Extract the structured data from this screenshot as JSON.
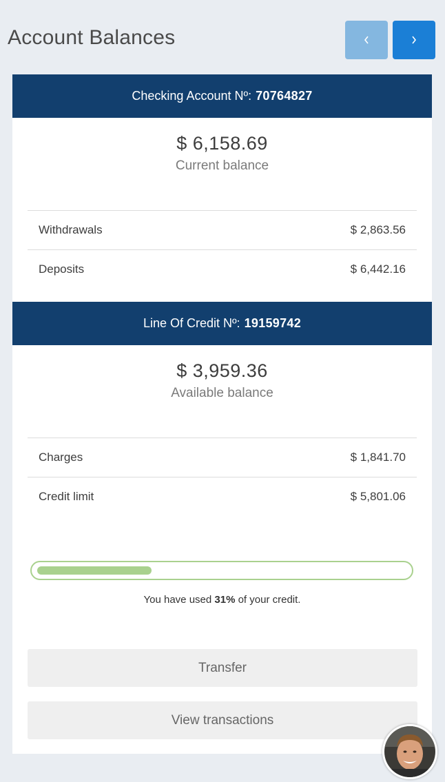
{
  "header": {
    "title": "Account Balances",
    "prev_label": "‹",
    "next_label": "›"
  },
  "checking": {
    "header_label": "Checking Account Nº:",
    "number": "70764827",
    "amount": "$ 6,158.69",
    "amount_label": "Current balance",
    "rows": [
      {
        "label": "Withdrawals",
        "value": "$ 2,863.56"
      },
      {
        "label": "Deposits",
        "value": "$ 6,442.16"
      }
    ]
  },
  "credit": {
    "header_label": "Line Of Credit Nº:",
    "number": "19159742",
    "amount": "$ 3,959.36",
    "amount_label": "Available balance",
    "rows": [
      {
        "label": "Charges",
        "value": "$ 1,841.70"
      },
      {
        "label": "Credit limit",
        "value": "$ 5,801.06"
      }
    ],
    "used_fraction": 0.31,
    "usage_prefix": "You have used",
    "usage_percent": "31%",
    "usage_suffix": "of your credit."
  },
  "actions": {
    "transfer_label": "Transfer",
    "view_transactions_label": "View transactions"
  },
  "colors": {
    "header_bg": "#123f6e",
    "nav_prev": "#84b7e0",
    "nav_next": "#1b7fd6",
    "progress": "#a9d18e"
  }
}
